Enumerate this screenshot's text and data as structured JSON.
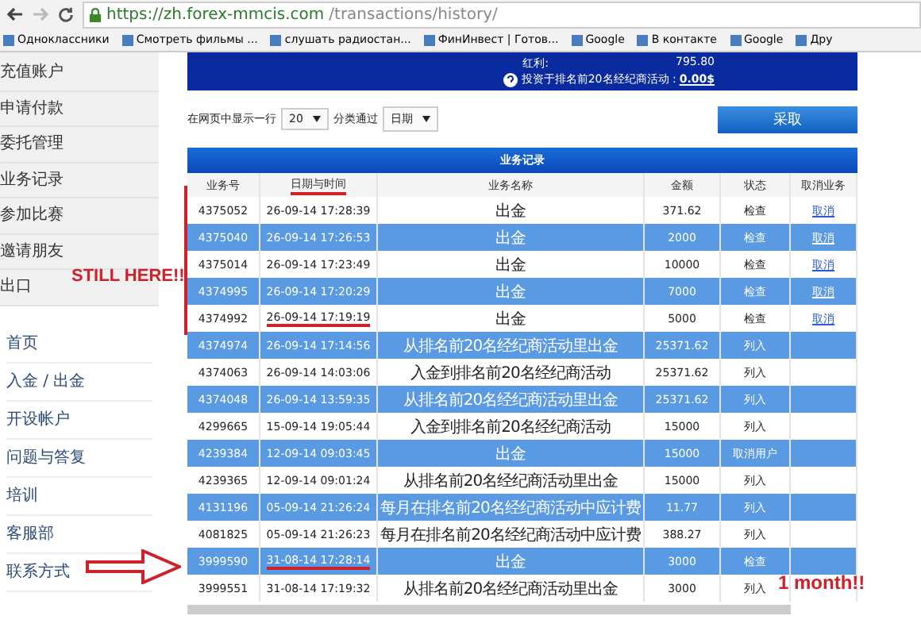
{
  "browser": {
    "url_host": "https://zh.forex-mmcis.com",
    "url_path": "/transactions/history/",
    "bookmarks": [
      "Одноклассники",
      "Смотреть фильмы ...",
      "слушать радиостан...",
      "ФинИнвест | Готов...",
      "Google",
      "В контакте",
      "Google",
      "Дру"
    ]
  },
  "submenu": [
    "充值账户",
    "申请付款",
    "委托管理",
    "业务记录",
    "参加比赛",
    "邀请朋友",
    "出口"
  ],
  "nav": [
    "首页",
    "入金 / 出金",
    "开设帐户",
    "问题与答复",
    "培训",
    "客服部",
    "联系方式"
  ],
  "summary": {
    "bonus_label": "红利:",
    "bonus_value": "795.80",
    "invest_label": "投资于排名前20名经纪商活动 :",
    "invest_value": "0.00$"
  },
  "filter": {
    "rows_label": "在网页中显示一行",
    "rows_value": "20",
    "sort_label": "分类通过",
    "sort_value": "日期",
    "button": "采取"
  },
  "table": {
    "title": "业务记录",
    "columns": [
      "业务号",
      "日期与时间",
      "业务名称",
      "金额",
      "状态",
      "取消业务"
    ],
    "date_header_underlined": true,
    "rows": [
      {
        "id": "4375052",
        "date": "26-09-14 17:28:39",
        "name": "出金",
        "amount": "371.62",
        "status": "检查",
        "cancel": "取消",
        "highlighted": false,
        "underlined": false
      },
      {
        "id": "4375040",
        "date": "26-09-14 17:26:53",
        "name": "出金",
        "amount": "2000",
        "status": "检查",
        "cancel": "取消",
        "highlighted": true,
        "underlined": false
      },
      {
        "id": "4375014",
        "date": "26-09-14 17:23:49",
        "name": "出金",
        "amount": "10000",
        "status": "检查",
        "cancel": "取消",
        "highlighted": false,
        "underlined": false
      },
      {
        "id": "4374995",
        "date": "26-09-14 17:20:29",
        "name": "出金",
        "amount": "7000",
        "status": "检查",
        "cancel": "取消",
        "highlighted": true,
        "underlined": false
      },
      {
        "id": "4374992",
        "date": "26-09-14 17:19:19",
        "name": "出金",
        "amount": "5000",
        "status": "检查",
        "cancel": "取消",
        "highlighted": false,
        "underlined": true
      },
      {
        "id": "4374974",
        "date": "26-09-14 17:14:56",
        "name": "从排名前20名经纪商活动里出金",
        "amount": "25371.62",
        "status": "列入",
        "highlighted": true,
        "underlined": false
      },
      {
        "id": "4374063",
        "date": "26-09-14 14:03:06",
        "name": "入金到排名前20名经纪商活动",
        "amount": "25371.62",
        "status": "列入",
        "highlighted": false,
        "underlined": false
      },
      {
        "id": "4374048",
        "date": "26-09-14 13:59:35",
        "name": "从排名前20名经纪商活动里出金",
        "amount": "25371.62",
        "status": "列入",
        "highlighted": true,
        "underlined": false
      },
      {
        "id": "4299665",
        "date": "15-09-14 19:05:44",
        "name": "入金到排名前20名经纪商活动",
        "amount": "15000",
        "status": "列入",
        "highlighted": false,
        "underlined": false
      },
      {
        "id": "4239384",
        "date": "12-09-14 09:03:45",
        "name": "出金",
        "amount": "15000",
        "status": "取消用户",
        "highlighted": true,
        "underlined": false
      },
      {
        "id": "4239365",
        "date": "12-09-14 09:01:24",
        "name": "从排名前20名经纪商活动里出金",
        "amount": "15000",
        "status": "列入",
        "highlighted": false,
        "underlined": false
      },
      {
        "id": "4131196",
        "date": "05-09-14 21:26:24",
        "name": "每月在排名前20名经纪商活动中应计费",
        "amount": "11.77",
        "status": "列入",
        "highlighted": true,
        "underlined": false
      },
      {
        "id": "4081825",
        "date": "05-09-14 21:26:23",
        "name": "每月在排名前20名经纪商活动中应计费",
        "amount": "388.27",
        "status": "列入",
        "highlighted": false,
        "underlined": false
      },
      {
        "id": "3999590",
        "date": "31-08-14 17:28:14",
        "name": "出金",
        "amount": "3000",
        "status": "检查",
        "highlighted": true,
        "underlined": true
      },
      {
        "id": "3999551",
        "date": "31-08-14 17:19:32",
        "name": "从排名前20名经纪商活动里出金",
        "amount": "3000",
        "status": "列入",
        "highlighted": false,
        "underlined": false
      }
    ]
  },
  "annotations": {
    "still_here": "STILL HERE!!",
    "one_month": "1 month!!"
  }
}
